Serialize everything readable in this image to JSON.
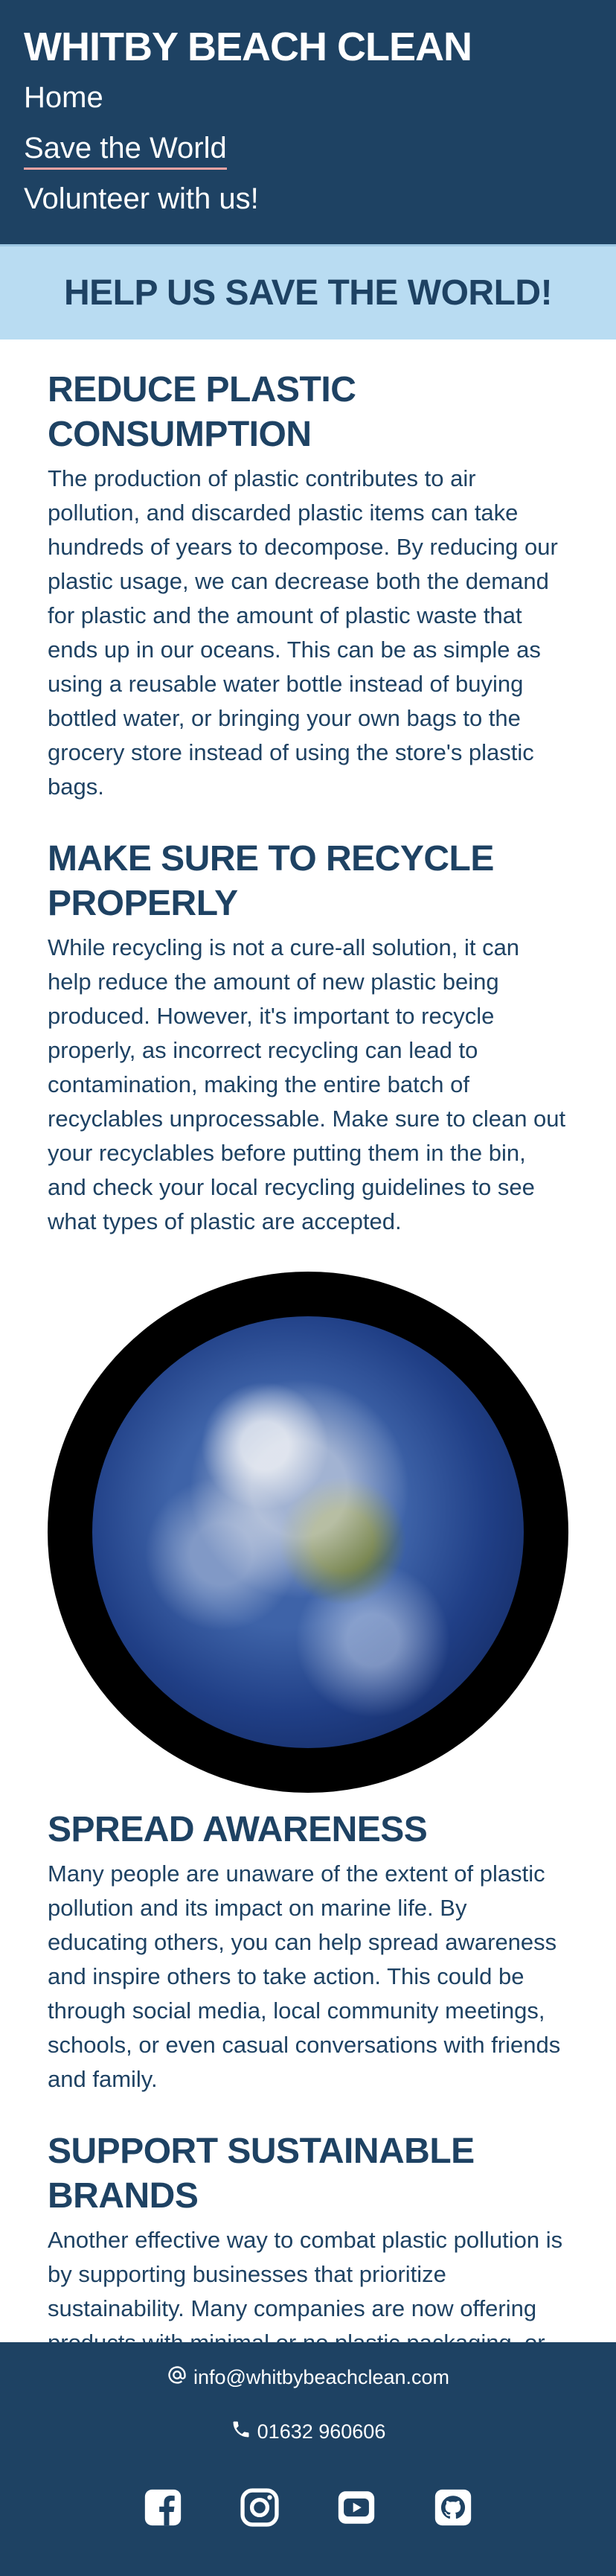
{
  "header": {
    "brand": "WHITBY BEACH CLEAN",
    "nav": [
      {
        "label": "Home"
      },
      {
        "label": "Save the World"
      },
      {
        "label": "Volunteer with us!"
      }
    ]
  },
  "banner": {
    "title": "HELP US SAVE THE WORLD!"
  },
  "sections": [
    {
      "heading": "REDUCE PLASTIC CONSUMPTION",
      "body": "The production of plastic contributes to air pollution, and discarded plastic items can take hundreds of years to decompose. By reducing our plastic usage, we can decrease both the demand for plastic and the amount of plastic waste that ends up in our oceans. This can be as simple as using a reusable water bottle instead of buying bottled water, or bringing your own bags to the grocery store instead of using the store's plastic bags."
    },
    {
      "heading": "MAKE SURE TO RECYCLE PROPERLY",
      "body": "While recycling is not a cure-all solution, it can help reduce the amount of new plastic being produced. However, it's important to recycle properly, as incorrect recycling can lead to contamination, making the entire batch of recyclables unprocessable. Make sure to clean out your recyclables before putting them in the bin, and check your local recycling guidelines to see what types of plastic are accepted."
    },
    {
      "heading": "SPREAD AWARENESS",
      "body": "Many people are unaware of the extent of plastic pollution and its impact on marine life. By educating others, you can help spread awareness and inspire others to take action. This could be through social media, local community meetings, schools, or even casual conversations with friends and family."
    },
    {
      "heading": "SUPPORT SUSTAINABLE BRANDS",
      "body": "Another effective way to combat plastic pollution is by supporting businesses that prioritize sustainability. Many companies are now offering products with minimal or no plastic packaging, or products made from recycled or biodegradable materials. By choosing to buy from these companies, you're not only reducing your own plastic footprint, but also encouraging more businesses to adopt sustainable practices"
    }
  ],
  "footer": {
    "email": "info@whitbybeachclean.com",
    "phone": "01632 960606",
    "socials": [
      "facebook-icon",
      "instagram-icon",
      "youtube-icon",
      "github-icon"
    ]
  },
  "colors": {
    "primary": "#1e4263",
    "banner": "#b9dcf2",
    "nav_underline": "#f2a3a3"
  }
}
